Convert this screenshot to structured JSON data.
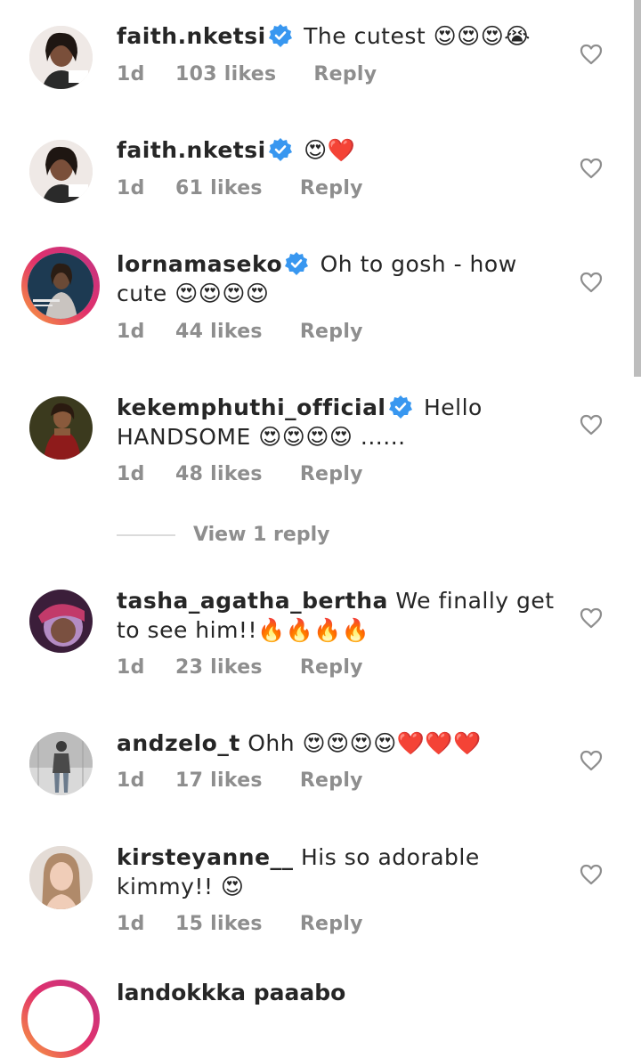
{
  "comments": [
    {
      "username": "faith.nketsi",
      "verified": true,
      "text": "The cutest 😍😍😍😭",
      "time": "1d",
      "likes": "103 likes",
      "reply": "Reply",
      "avatar": "woman-portrait"
    },
    {
      "username": "faith.nketsi",
      "verified": true,
      "text": "😍❤️",
      "time": "1d",
      "likes": "61 likes",
      "reply": "Reply",
      "avatar": "woman-portrait"
    },
    {
      "username": "lornamaseko",
      "verified": true,
      "text": "Oh to gosh - how cute 😍😍😍😍",
      "time": "1d",
      "likes": "44 likes",
      "reply": "Reply",
      "avatar": "magazine-cover"
    },
    {
      "username": "kekemphuthi_official",
      "verified": true,
      "text": "Hello HANDSOME 😍😍😍😍 ......",
      "time": "1d",
      "likes": "48 likes",
      "reply": "Reply",
      "avatar": "woman-red-dress"
    },
    {
      "username": "tasha_agatha_bertha",
      "verified": false,
      "text": "We finally get to see him!!🔥🔥🔥🔥",
      "time": "1d",
      "likes": "23 likes",
      "reply": "Reply",
      "avatar": "woman-headwrap"
    },
    {
      "username": "andzelo_t",
      "verified": false,
      "text": "Ohh 😍😍😍😍❤️❤️❤️",
      "time": "1d",
      "likes": "17 likes",
      "reply": "Reply",
      "avatar": "man-standing"
    },
    {
      "username": "kirsteyanne__",
      "verified": false,
      "text": "His so adorable kimmy!! 😍",
      "time": "1d",
      "likes": "15 likes",
      "reply": "Reply",
      "avatar": "woman-selfie"
    }
  ],
  "view_replies": "View 1 reply",
  "partial_comment": "landokkka paaabo",
  "icons": {
    "heart": "heart-outline-icon",
    "verified": "verified-badge-icon"
  },
  "colors": {
    "verified": "#3897f0",
    "meta": "#8e8e8e",
    "text": "#262626"
  }
}
